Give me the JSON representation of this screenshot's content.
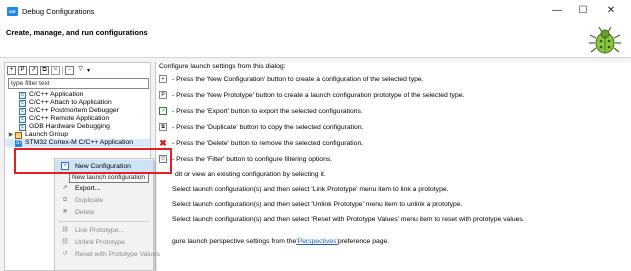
{
  "window": {
    "title": "Debug Configurations",
    "app_icon": "IDE",
    "controls": [
      "—",
      "☐",
      "✕"
    ]
  },
  "header": {
    "title": "Create, manage, and run configurations"
  },
  "left_panel": {
    "filter_placeholder": "type filter text",
    "toolbar": [
      "new-config-icon",
      "new-prototype-icon",
      "export-icon",
      "duplicate-icon",
      "delete-icon",
      "collapse-icon",
      "filter-icon",
      "dropdown-icon"
    ],
    "tree": [
      {
        "label": "C/C++ Application",
        "level": "indent"
      },
      {
        "label": "C/C++ Attach to Application",
        "level": "indent"
      },
      {
        "label": "C/C++ Postmortem Debugger",
        "level": "indent"
      },
      {
        "label": "C/C++ Remote Application",
        "level": "indent"
      },
      {
        "label": "GDB Hardware Debugging",
        "level": "indent"
      },
      {
        "label": "Launch Group",
        "level": "root",
        "twisty": "▶"
      },
      {
        "label": "STM32 Cortex-M C/C++ Application",
        "level": "root",
        "selected": true
      }
    ]
  },
  "right_panel": {
    "intro": "Configure launch settings from this dialog:",
    "lines": [
      {
        "text": "- Press the 'New Configuration' button to create a configuration of the selected type.",
        "icon": "new-config-icon"
      },
      {
        "text": "- Press the 'New Prototype' button to create a launch configuration prototype of the selected type.",
        "icon": "new-prototype-icon"
      },
      {
        "text": "- Press the 'Export' button to export the selected configurations.",
        "icon": "export-icon"
      },
      {
        "text": "- Press the 'Duplicate' button to copy the selected configuration.",
        "icon": "duplicate-icon"
      },
      {
        "text": "- Press the 'Delete' button to remove the selected configuration.",
        "icon": "delete-icon"
      },
      {
        "text": "- Press the 'Filter' button to configure filtering options.",
        "icon": "filter-icon"
      },
      {
        "text": "dit or view an existing configuration by selecting it.",
        "icon": ""
      },
      {
        "text": "Select launch configuration(s) and then select 'Link Prototype' menu item to link a prototype.",
        "icon": ""
      },
      {
        "text": "Select launch configuration(s) and then select 'Unlink Prototype' menu item to unlink a prototype.",
        "icon": ""
      },
      {
        "text": "Select launch configuration(s) and then select 'Reset with Prototype Values' menu item to reset with prototype values.",
        "icon": ""
      }
    ],
    "perspective_prefix": "gure launch perspective settings from the ",
    "perspective_link": "'Perspectives'",
    "perspective_suffix": " preference page."
  },
  "context_menu": {
    "items": [
      {
        "label": "New Configuration",
        "icon": "new-config-icon",
        "state": "highlighted"
      },
      {
        "label": "Export...",
        "icon": "export-icon",
        "state": "enabled"
      },
      {
        "label": "Duplicate",
        "icon": "duplicate-icon",
        "state": "disabled"
      },
      {
        "label": "Delete",
        "icon": "delete-icon",
        "state": "disabled"
      },
      {
        "label": "Link Prototype...",
        "icon": "link-icon",
        "state": "disabled"
      },
      {
        "label": "Unlink Prototype",
        "icon": "unlink-icon",
        "state": "disabled"
      },
      {
        "label": "Reset with Prototype Values",
        "icon": "reset-icon",
        "state": "disabled"
      }
    ],
    "tooltip": "New launch configuration"
  },
  "colors": {
    "accent": "#1e88e5",
    "highlight_box": "#e31e24",
    "link": "#1a5fb4",
    "menu_highlight": "#cfe3f8"
  }
}
